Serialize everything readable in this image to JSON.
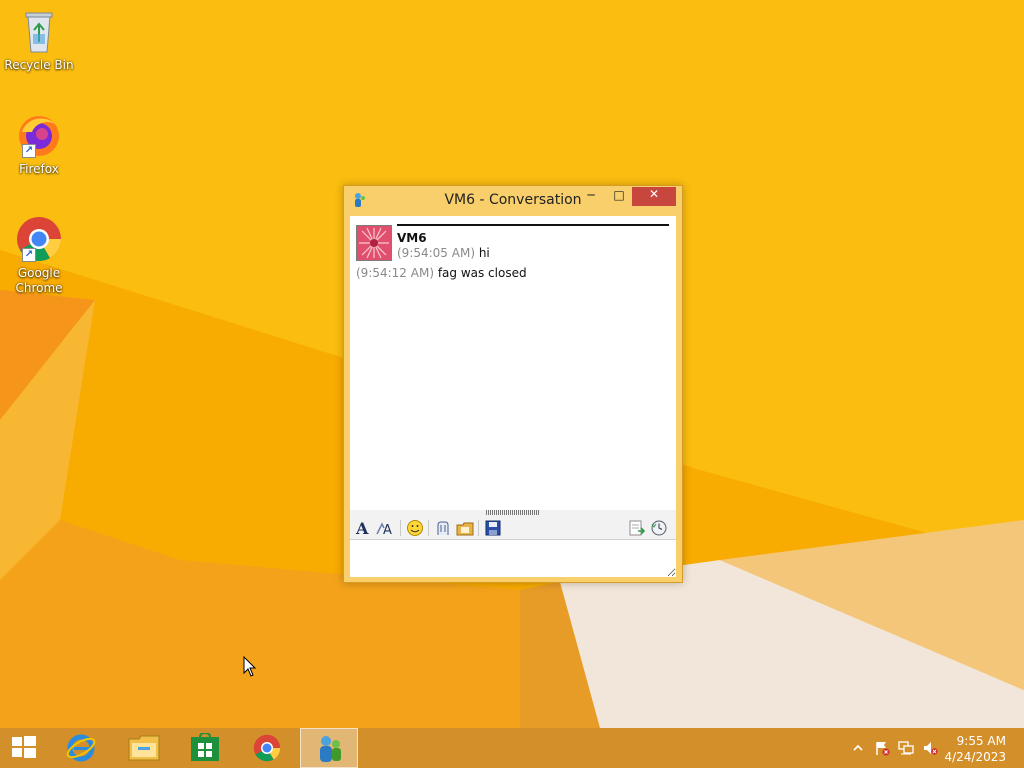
{
  "desktop": {
    "icons": [
      {
        "label": "Recycle Bin",
        "icon": "recycle-bin-icon"
      },
      {
        "label": "Firefox",
        "icon": "firefox-icon"
      },
      {
        "label": "Google Chrome",
        "icon": "chrome-icon"
      }
    ]
  },
  "window": {
    "title": "VM6 - Conversation",
    "controls": {
      "minimize": "─",
      "maximize": "□",
      "close": "✕"
    },
    "conversation": {
      "sender": "VM6",
      "messages": [
        {
          "time": "(9:54:05 AM)",
          "text": " hi"
        },
        {
          "time": "(9:54:12 AM)",
          "text": " fag was closed"
        }
      ]
    },
    "toolbar": {
      "font_glyph": "A"
    },
    "input": {
      "value": ""
    }
  },
  "taskbar": {
    "clock": {
      "time": "9:55 AM",
      "date": "4/24/2023"
    }
  },
  "colors": {
    "wallpaper": "#f7a900",
    "taskbar": "#d3902a",
    "window_frame": "#f8cf6a",
    "close_button": "#c7463e"
  }
}
